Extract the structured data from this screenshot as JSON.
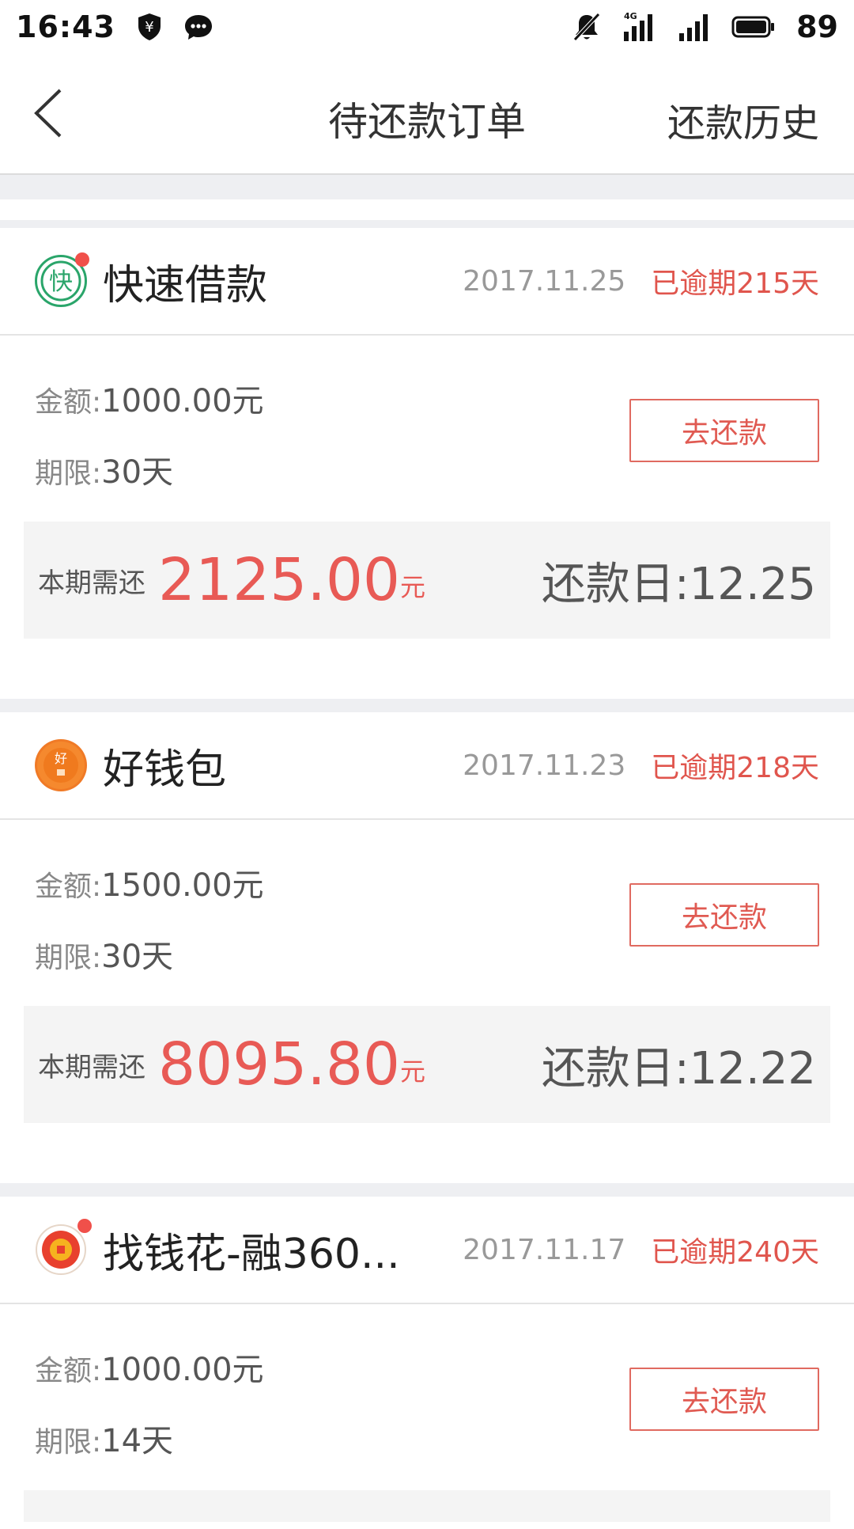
{
  "status_bar": {
    "time": "16:43",
    "battery": "89",
    "network": "4G"
  },
  "nav": {
    "title": "待还款订单",
    "history": "还款历史"
  },
  "orders": [
    {
      "app_name": "快速借款",
      "date": "2017.11.25",
      "overdue": "已逾期215天",
      "amount_label": "金额:",
      "amount": "1000.00元",
      "term_label": "期限:",
      "term": "30天",
      "button": "去还款",
      "due_label": "本期需还",
      "due_amount": "2125.00",
      "due_unit": "元",
      "due_date": "还款日:12.25",
      "logo_char": "快"
    },
    {
      "app_name": "好钱包",
      "date": "2017.11.23",
      "overdue": "已逾期218天",
      "amount_label": "金额:",
      "amount": "1500.00元",
      "term_label": "期限:",
      "term": "30天",
      "button": "去还款",
      "due_label": "本期需还",
      "due_amount": "8095.80",
      "due_unit": "元",
      "due_date": "还款日:12.22",
      "logo_char": "好"
    },
    {
      "app_name": "找钱花-融360...",
      "date": "2017.11.17",
      "overdue": "已逾期240天",
      "amount_label": "金额:",
      "amount": "1000.00元",
      "term_label": "期限:",
      "term": "14天",
      "button": "去还款"
    }
  ],
  "colors": {
    "accent_red": "#e85a55",
    "gray_text": "#999999"
  }
}
